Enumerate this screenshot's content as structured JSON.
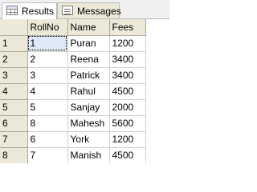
{
  "tabs": [
    {
      "label": "Results",
      "icon": "grid-icon",
      "selected": true
    },
    {
      "label": "Messages",
      "icon": "messages-icon",
      "selected": false
    }
  ],
  "grid": {
    "columns": [
      "",
      "RollNo",
      "Name",
      "Fees"
    ],
    "rows": [
      {
        "row": "1",
        "rollno": "1",
        "name": "Puran",
        "fees": "1200"
      },
      {
        "row": "2",
        "rollno": "2",
        "name": "Reena",
        "fees": "3400"
      },
      {
        "row": "3",
        "rollno": "3",
        "name": "Patrick",
        "fees": "3400"
      },
      {
        "row": "4",
        "rollno": "4",
        "name": "Rahul",
        "fees": "4500"
      },
      {
        "row": "5",
        "rollno": "5",
        "name": "Sanjay",
        "fees": "2000"
      },
      {
        "row": "6",
        "rollno": "8",
        "name": "Mahesh",
        "fees": "5600"
      },
      {
        "row": "7",
        "rollno": "6",
        "name": "York",
        "fees": "1200"
      },
      {
        "row": "8",
        "rollno": "7",
        "name": "Manish",
        "fees": "4500"
      }
    ]
  },
  "colors": {
    "header_bg": "#ece9d8",
    "selected_cell_bg": "#dfe8f6",
    "grid_line": "#d4d0c8"
  }
}
